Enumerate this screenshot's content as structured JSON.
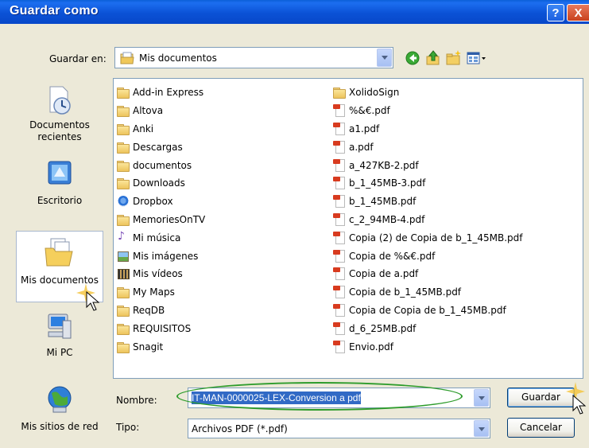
{
  "window": {
    "title": "Guardar como",
    "help_label": "?",
    "close_label": "X"
  },
  "toolbar": {
    "save_in_label": "Guardar en:",
    "location": "Mis documentos"
  },
  "places": [
    {
      "label": "Documentos recientes",
      "icon": "recent-documents-icon"
    },
    {
      "label": "Escritorio",
      "icon": "desktop-icon"
    },
    {
      "label": "Mis documentos",
      "icon": "my-documents-icon"
    },
    {
      "label": "Mi PC",
      "icon": "my-computer-icon"
    },
    {
      "label": "Mis sitios de red",
      "icon": "network-places-icon"
    }
  ],
  "files_col1": [
    {
      "name": "Add-in Express",
      "type": "folder"
    },
    {
      "name": "Altova",
      "type": "folder"
    },
    {
      "name": "Anki",
      "type": "folder"
    },
    {
      "name": "Descargas",
      "type": "folder"
    },
    {
      "name": "documentos",
      "type": "folder"
    },
    {
      "name": "Downloads",
      "type": "folder"
    },
    {
      "name": "Dropbox",
      "type": "dropbox"
    },
    {
      "name": "MemoriesOnTV",
      "type": "folder"
    },
    {
      "name": "Mi música",
      "type": "music"
    },
    {
      "name": "Mis imágenes",
      "type": "images"
    },
    {
      "name": "Mis vídeos",
      "type": "videos"
    },
    {
      "name": "My Maps",
      "type": "folder"
    },
    {
      "name": "ReqDB",
      "type": "folder"
    },
    {
      "name": "REQUISITOS",
      "type": "folder"
    },
    {
      "name": "Snagit",
      "type": "folder"
    }
  ],
  "files_col2": [
    {
      "name": "XolidoSign",
      "type": "folder"
    },
    {
      "name": "%&€.pdf",
      "type": "pdf"
    },
    {
      "name": "a1.pdf",
      "type": "pdf"
    },
    {
      "name": "a.pdf",
      "type": "pdf"
    },
    {
      "name": "a_427KB-2.pdf",
      "type": "pdf"
    },
    {
      "name": "b_1_45MB-3.pdf",
      "type": "pdf"
    },
    {
      "name": "b_1_45MB.pdf",
      "type": "pdf"
    },
    {
      "name": "c_2_94MB-4.pdf",
      "type": "pdf"
    },
    {
      "name": "Copia (2) de Copia de b_1_45MB.pdf",
      "type": "pdf"
    },
    {
      "name": "Copia de %&€.pdf",
      "type": "pdf"
    },
    {
      "name": "Copia de a.pdf",
      "type": "pdf"
    },
    {
      "name": "Copia de b_1_45MB.pdf",
      "type": "pdf"
    },
    {
      "name": "Copia de Copia de b_1_45MB.pdf",
      "type": "pdf"
    },
    {
      "name": "d_6_25MB.pdf",
      "type": "pdf"
    },
    {
      "name": "Envio.pdf",
      "type": "pdf"
    }
  ],
  "form": {
    "name_label": "Nombre:",
    "name_value": "IT-MAN-0000025-LEX-Conversion a pdf",
    "type_label": "Tipo:",
    "type_value": "Archivos PDF (*.pdf)"
  },
  "buttons": {
    "save": "Guardar",
    "cancel": "Cancelar"
  },
  "colors": {
    "titlebar": "#0b52d6",
    "selection": "#316ac5",
    "annotation_ellipse": "#2e9c2c"
  }
}
